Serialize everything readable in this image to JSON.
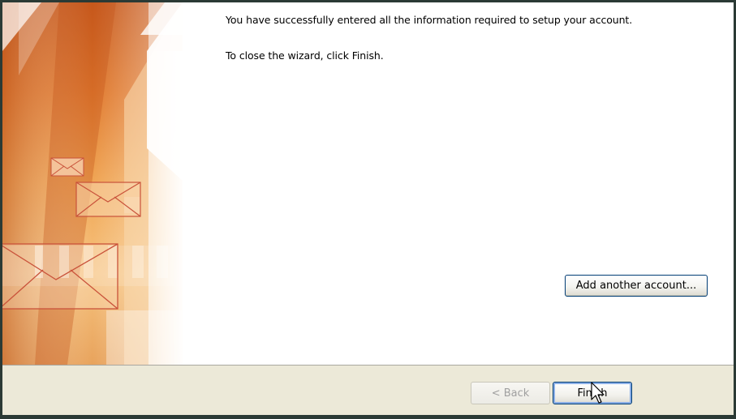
{
  "wizard": {
    "message_success": "You have successfully entered all the information required to setup your account.",
    "message_close": "To close the wizard, click Finish.",
    "add_account_label": "Add another account...",
    "back_label": "< Back",
    "finish_label": "Finish"
  },
  "colors": {
    "footer_bg": "#ece9d8",
    "button_border": "#003c74",
    "banner_orange": "#d96f2a"
  },
  "icons": [
    "envelope-graphic",
    "mouse-pointer-icon"
  ]
}
